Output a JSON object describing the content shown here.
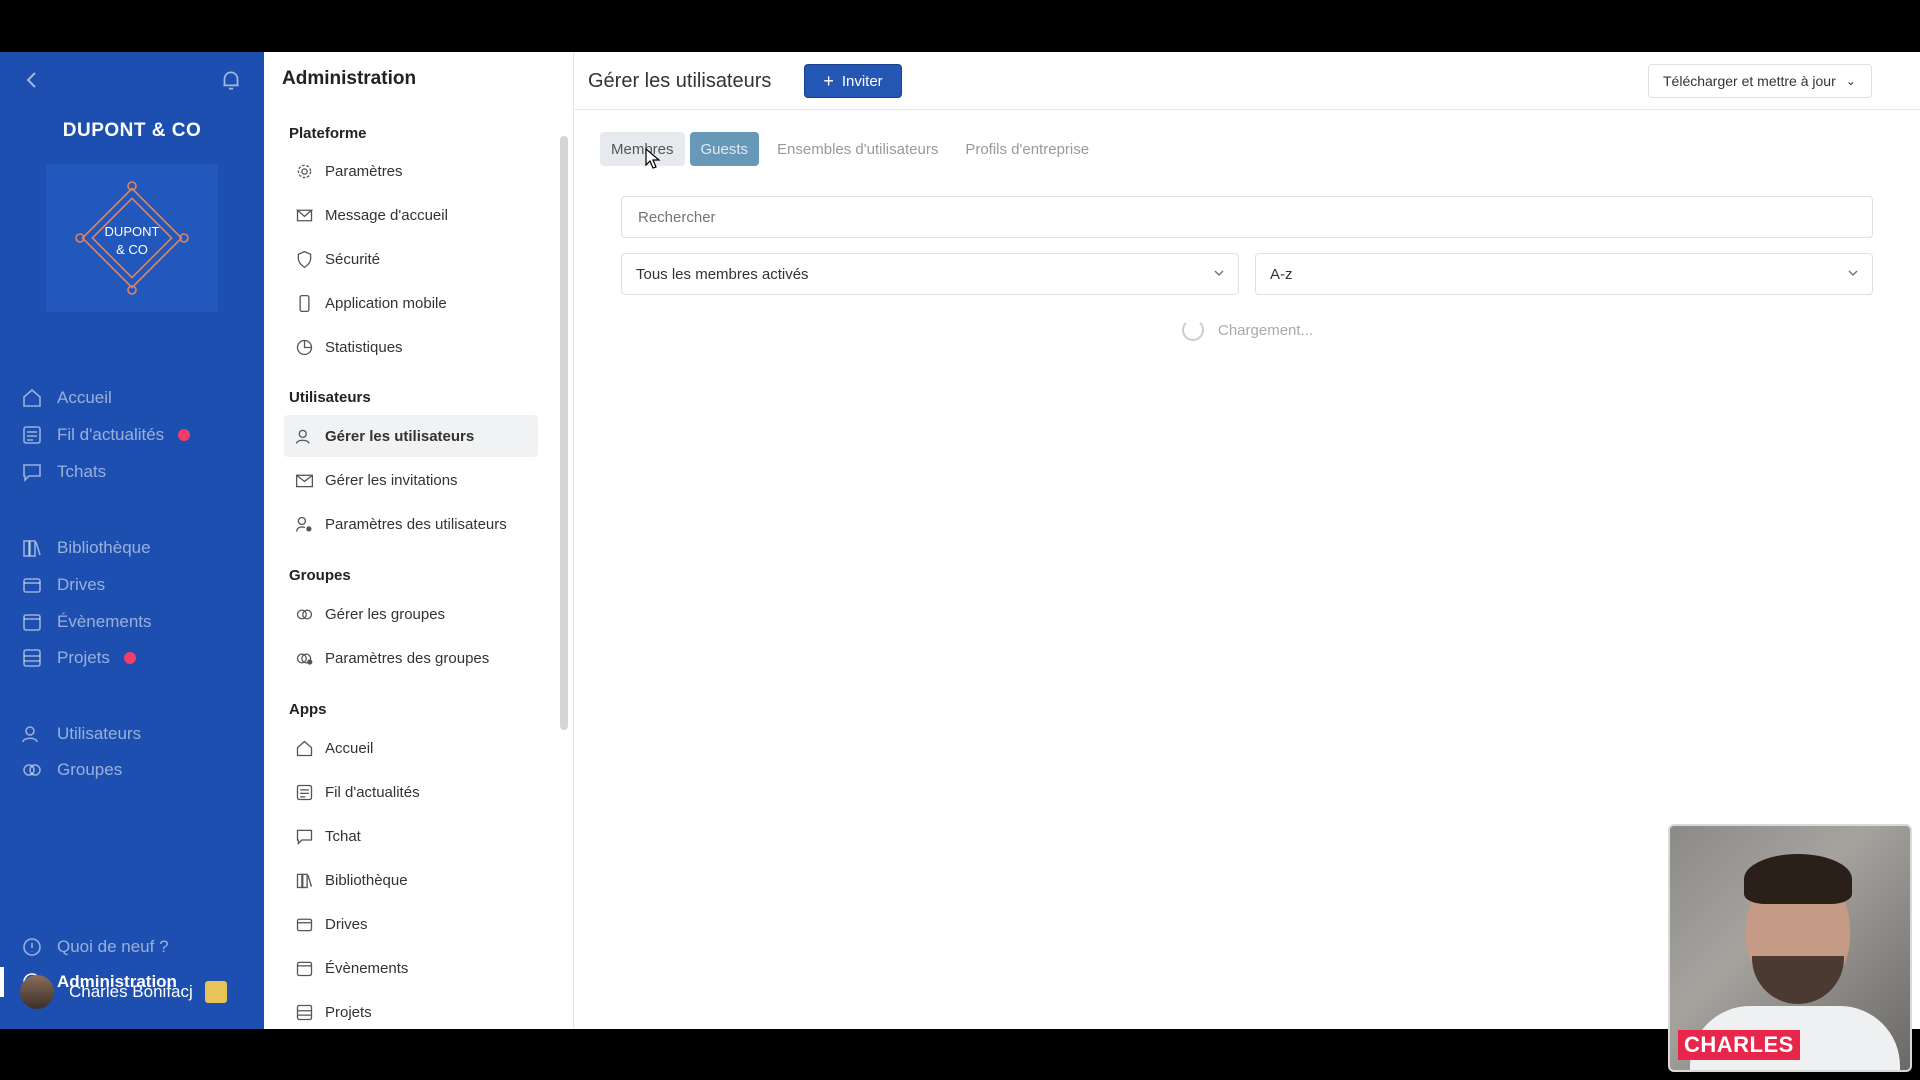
{
  "app_sidebar": {
    "brand": "DUPONT & CO",
    "logo_text_line1": "DUPONT",
    "logo_text_line2": "& CO",
    "items": [
      {
        "label": "Accueil",
        "icon": "home-icon"
      },
      {
        "label": "Fil d'actualités",
        "icon": "feed-icon",
        "badge": true
      },
      {
        "label": "Tchats",
        "icon": "chat-icon"
      },
      {
        "label": "Bibliothèque",
        "icon": "library-icon"
      },
      {
        "label": "Drives",
        "icon": "drive-icon"
      },
      {
        "label": "Évènements",
        "icon": "calendar-icon"
      },
      {
        "label": "Projets",
        "icon": "projects-icon",
        "badge": true
      },
      {
        "label": "Utilisateurs",
        "icon": "users-icon"
      },
      {
        "label": "Groupes",
        "icon": "groups-icon"
      },
      {
        "label": "Quoi de neuf ?",
        "icon": "whats-new-icon"
      },
      {
        "label": "Administration",
        "icon": "admin-gear-icon",
        "active": true
      }
    ],
    "user_name": "Charles Bonifacj",
    "badge_color": "#f43d6b"
  },
  "admin_panel": {
    "title": "Administration",
    "sections": {
      "platform": "Plateforme",
      "users": "Utilisateurs",
      "groups": "Groupes",
      "apps": "Apps"
    },
    "platform_items": [
      "Paramètres",
      "Message d'accueil",
      "Sécurité",
      "Application mobile",
      "Statistiques"
    ],
    "users_items": [
      "Gérer les utilisateurs",
      "Gérer les invitations",
      "Paramètres des utilisateurs"
    ],
    "groups_items": [
      "Gérer les groupes",
      "Paramètres des groupes"
    ],
    "apps_items": [
      "Accueil",
      "Fil d'actualités",
      "Tchat",
      "Bibliothèque",
      "Drives",
      "Évènements",
      "Projets"
    ]
  },
  "main": {
    "title": "Gérer les utilisateurs",
    "invite_label": "Inviter",
    "download_label": "Télécharger et mettre à jour",
    "tabs": [
      "Membres",
      "Guests",
      "Ensembles d'utilisateurs",
      "Profils d'entreprise"
    ],
    "search_placeholder": "Rechercher",
    "filter_value": "Tous les membres activés",
    "sort_value": "A-z",
    "loading_text": "Chargement..."
  },
  "webcam": {
    "name": "CHARLES"
  },
  "colors": {
    "sidebar_bg": "#1c4fb0",
    "primary": "#2456b4",
    "guests_tab": "#6798b8"
  }
}
